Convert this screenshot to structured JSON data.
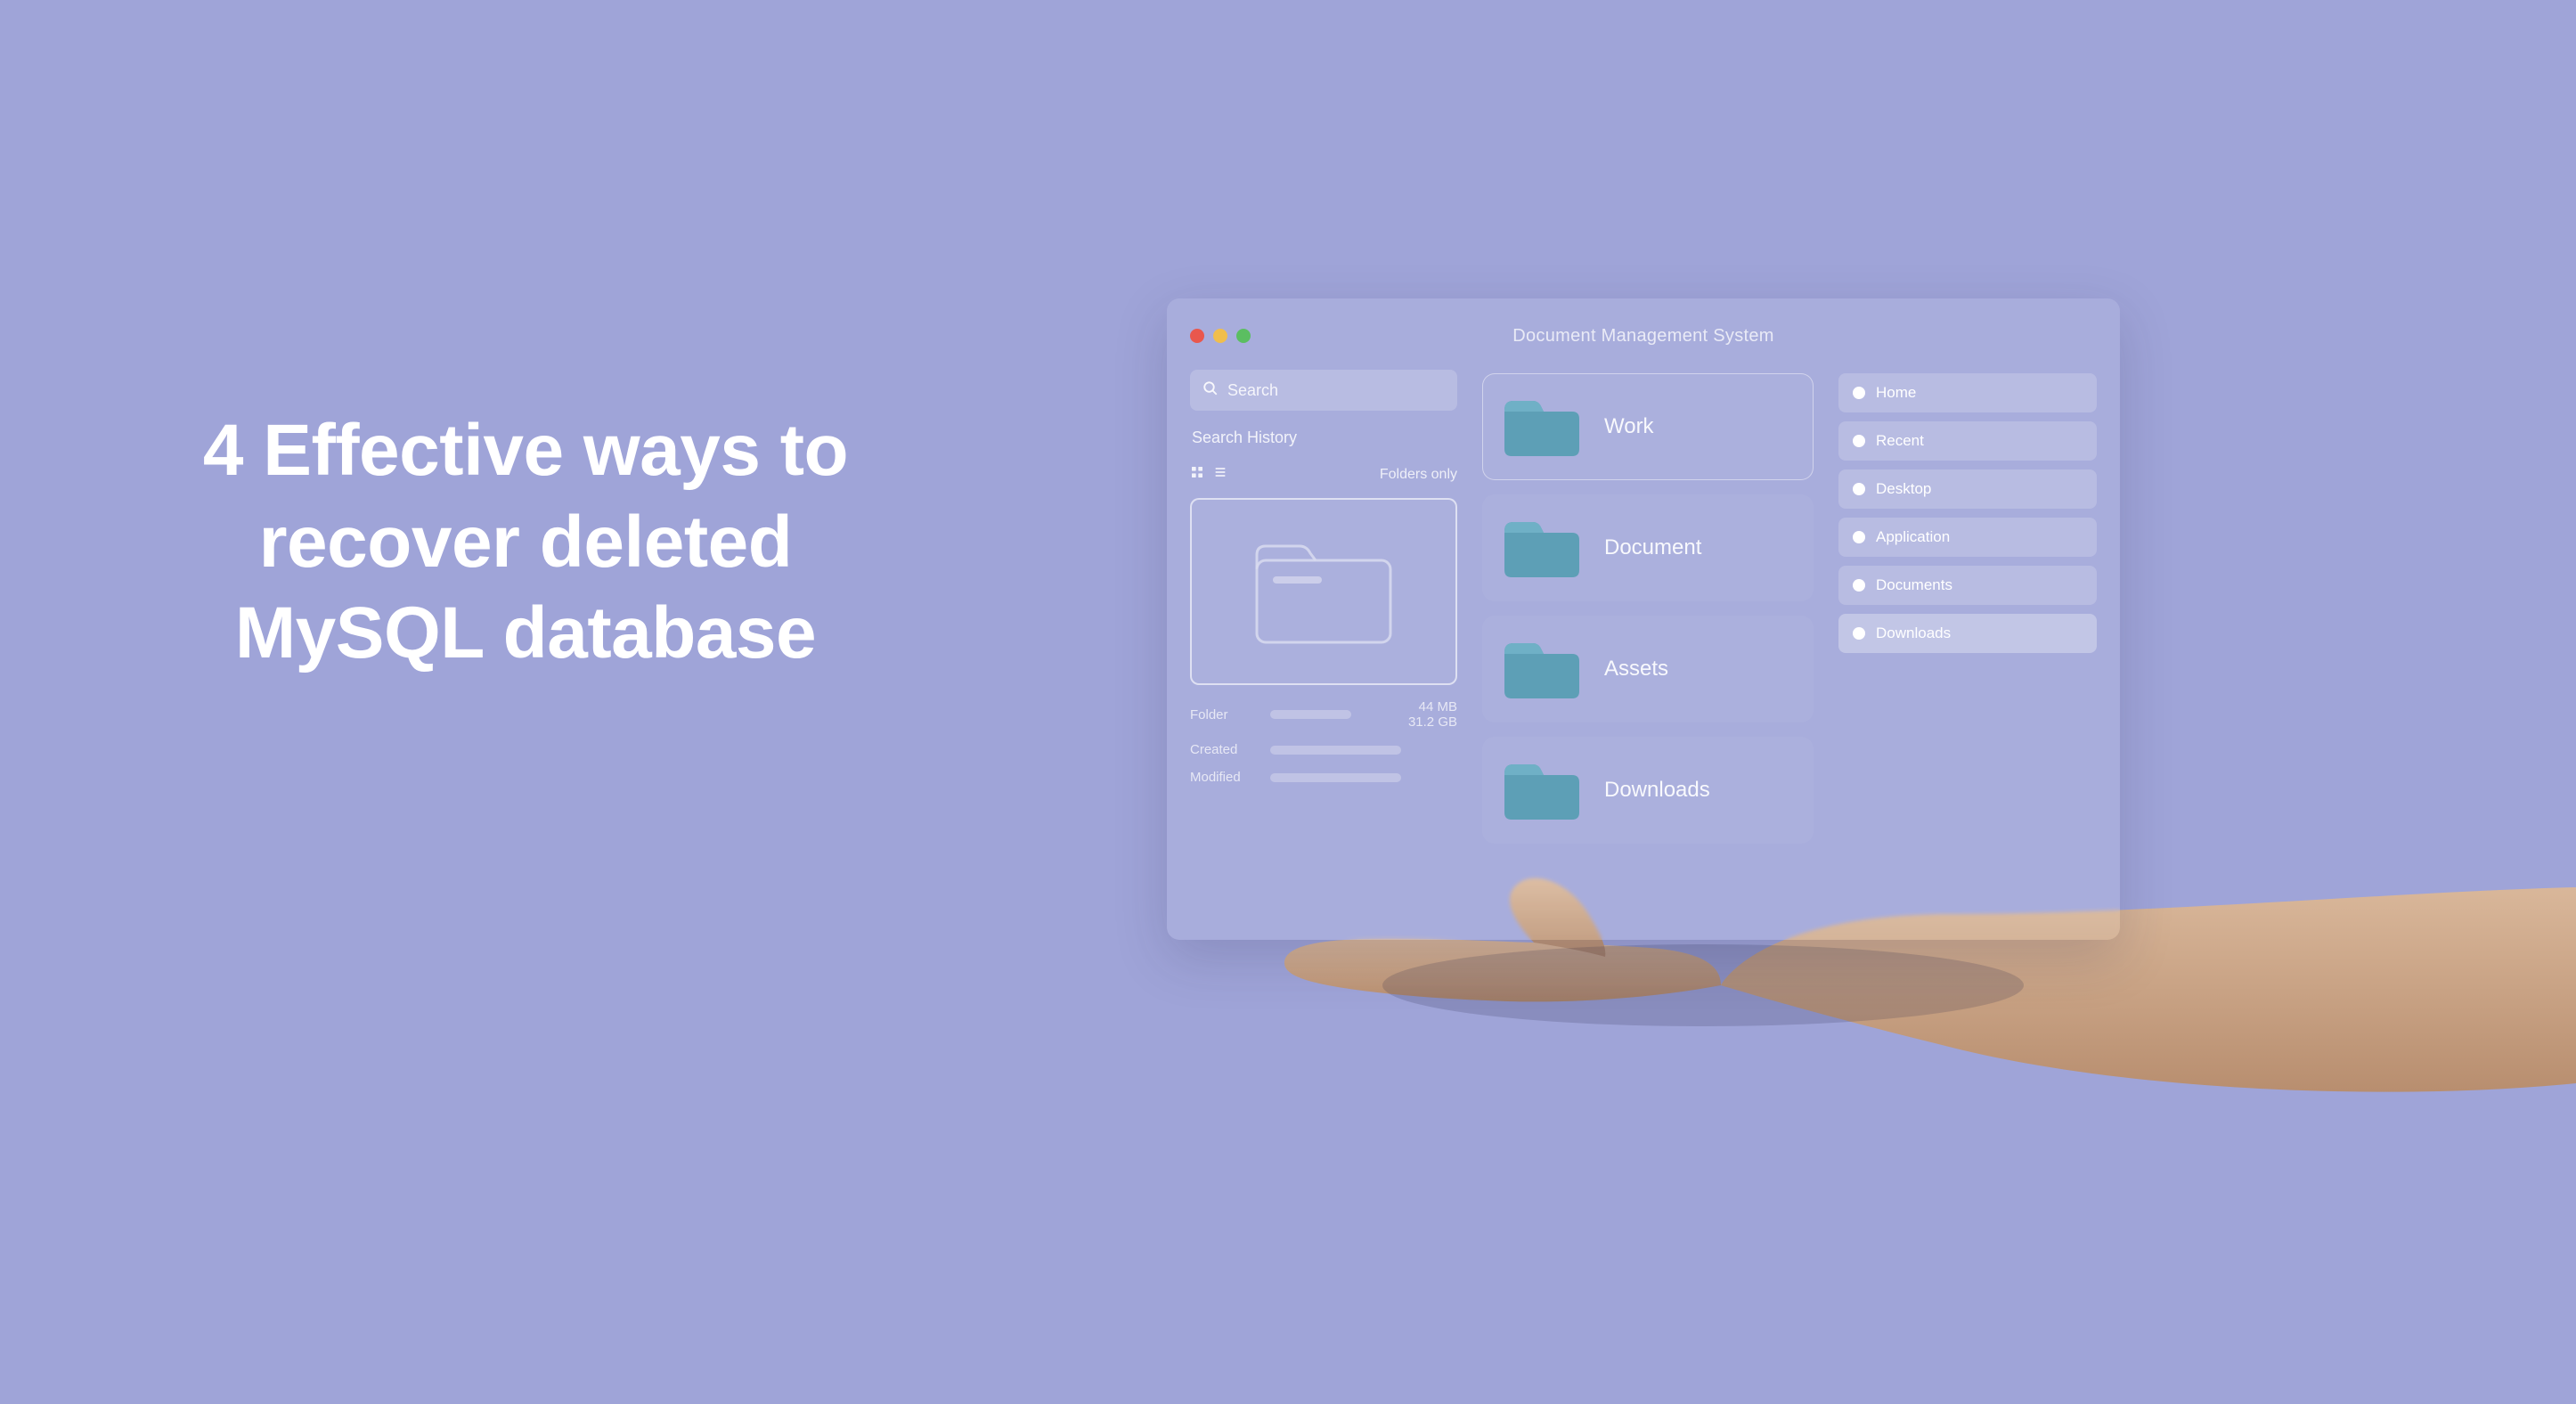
{
  "headline": "4 Effective ways to recover deleted MySQL database",
  "panel": {
    "window_title": "Document Management System",
    "search_placeholder": "Search",
    "search_history_label": "Search History",
    "folders_only_label": "Folders only",
    "meta": {
      "folder_label": "Folder",
      "folder_size1": "44 MB",
      "folder_size2": "31.2 GB",
      "created_label": "Created",
      "modified_label": "Modified"
    },
    "folders": [
      {
        "label": "Work"
      },
      {
        "label": "Document"
      },
      {
        "label": "Assets"
      },
      {
        "label": "Downloads"
      }
    ],
    "nav": [
      {
        "label": "Home",
        "highlight": false
      },
      {
        "label": "Recent",
        "highlight": false
      },
      {
        "label": "Desktop",
        "highlight": false
      },
      {
        "label": "Application",
        "highlight": false
      },
      {
        "label": "Documents",
        "highlight": false
      },
      {
        "label": "Downloads",
        "highlight": true
      }
    ]
  },
  "colors": {
    "folder_fill": "#5d9fb6",
    "folder_tab": "#6fb0c6"
  }
}
